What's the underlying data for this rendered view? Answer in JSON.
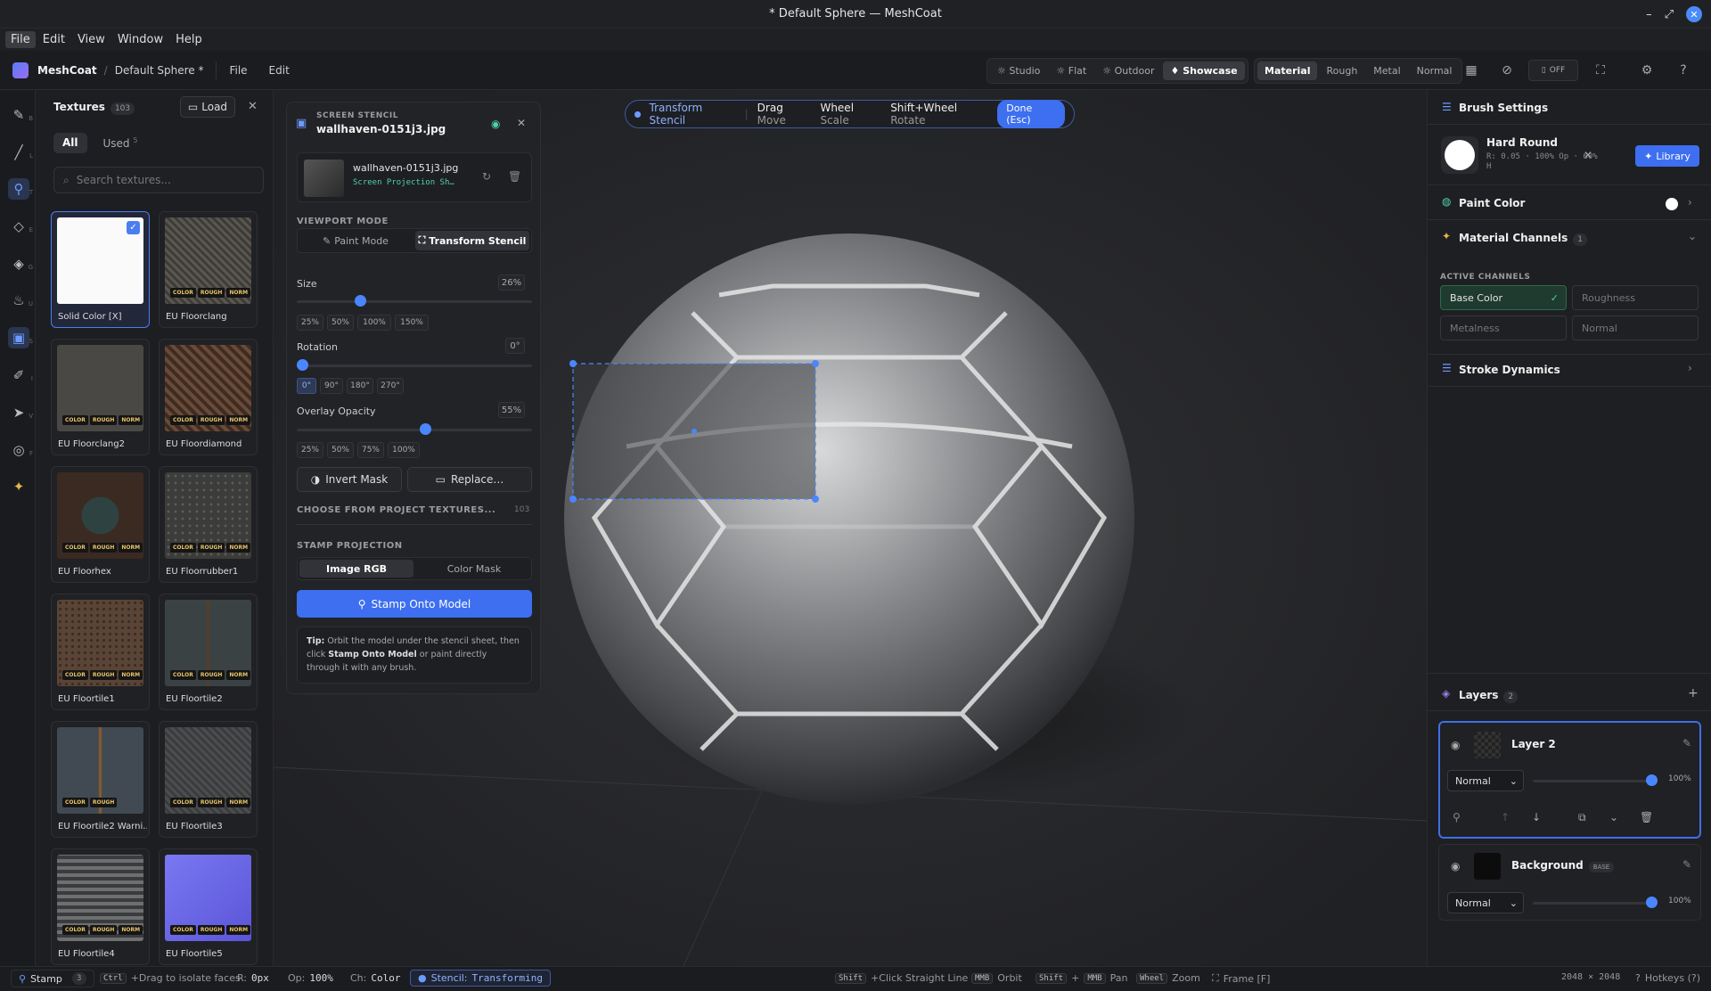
{
  "window": {
    "title": "* Default Sphere — MeshCoat"
  },
  "menubar": [
    "File",
    "Edit",
    "View",
    "Window",
    "Help"
  ],
  "toolbar": {
    "brand": "MeshCoat",
    "doc": "Default Sphere *",
    "menus": [
      "File",
      "Edit"
    ],
    "lighting": [
      "Studio",
      "Flat",
      "Outdoor",
      "Showcase"
    ],
    "lighting_active": "Showcase",
    "view_modes": [
      "Material",
      "Rough",
      "Metal",
      "Normal"
    ],
    "view_active": "Material",
    "symmetry": "OFF"
  },
  "rail_keys": [
    "B",
    "L",
    "T",
    "E",
    "G",
    "U",
    "S",
    "I",
    "V",
    "F"
  ],
  "textures": {
    "title": "Textures",
    "count": "103",
    "load": "Load",
    "tab_all": "All",
    "tab_used": "Used",
    "used_count": "5",
    "search_placeholder": "Search textures...",
    "items": [
      {
        "name": "Solid Color [X]",
        "tags": []
      },
      {
        "name": "EU Floorclang",
        "tags": [
          "COLOR",
          "ROUGH",
          "NORM"
        ]
      },
      {
        "name": "EU Floorclang2",
        "tags": [
          "COLOR",
          "ROUGH",
          "NORM"
        ]
      },
      {
        "name": "EU Floordiamond",
        "tags": [
          "COLOR",
          "ROUGH",
          "NORM"
        ]
      },
      {
        "name": "EU Floorhex",
        "tags": [
          "COLOR",
          "ROUGH",
          "NORM"
        ]
      },
      {
        "name": "EU Floorrubber1",
        "tags": [
          "COLOR",
          "ROUGH",
          "NORM"
        ]
      },
      {
        "name": "EU Floortile1",
        "tags": [
          "COLOR",
          "ROUGH",
          "NORM"
        ]
      },
      {
        "name": "EU Floortile2",
        "tags": [
          "COLOR",
          "ROUGH",
          "NORM"
        ]
      },
      {
        "name": "EU Floortile2 Warni...",
        "tags": [
          "COLOR",
          "ROUGH"
        ]
      },
      {
        "name": "EU Floortile3",
        "tags": [
          "COLOR",
          "ROUGH",
          "NORM"
        ]
      },
      {
        "name": "EU Floortile4",
        "tags": [
          "COLOR",
          "ROUGH",
          "NORM"
        ]
      },
      {
        "name": "EU Floortile5",
        "tags": [
          "COLOR",
          "ROUGH",
          "NORM"
        ]
      }
    ]
  },
  "stencil": {
    "kicker": "SCREEN STENCIL",
    "file": "wallhaven-0151j3.jpg",
    "file_sub": "Screen Projection Sh…",
    "viewport_mode_label": "VIEWPORT MODE",
    "paint_mode": "Paint Mode",
    "transform_stencil": "Transform Stencil",
    "size_label": "Size",
    "size_value": "26%",
    "size_fraction": 0.26,
    "size_presets": [
      "25%",
      "50%",
      "100%",
      "150%"
    ],
    "rotation_label": "Rotation",
    "rotation_value": "0°",
    "rotation_presets": [
      "0°",
      "90°",
      "180°",
      "270°"
    ],
    "opacity_label": "Overlay Opacity",
    "opacity_value": "55%",
    "opacity_fraction": 0.55,
    "opacity_presets": [
      "25%",
      "50%",
      "75%",
      "100%"
    ],
    "invert_mask": "Invert Mask",
    "replace": "Replace…",
    "choose": "CHOOSE FROM PROJECT TEXTURES...",
    "choose_count": "103",
    "projection_label": "STAMP PROJECTION",
    "image_rgb": "Image RGB",
    "color_mask": "Color Mask",
    "stamp_btn": "Stamp Onto Model",
    "tip_bold": "Tip:",
    "tip_1": " Orbit the model under the stencil sheet, then click ",
    "tip_bold2": "Stamp Onto Model",
    "tip_2": " or paint directly through it with any brush."
  },
  "overlay": {
    "mode": "Transform Stencil",
    "drag": "Drag",
    "drag_act": "Move",
    "wheel": "Wheel",
    "wheel_act": "Scale",
    "shiftwheel": "Shift+Wheel",
    "shiftwheel_act": "Rotate",
    "done": "Done (Esc)"
  },
  "brush": {
    "title": "Brush Settings",
    "name": "Hard Round",
    "params": "R: 0.05 · 100% Op · 60% H",
    "r": "R: 0.05",
    "op": "100% Op",
    "h": "60% H",
    "library": "Library",
    "paint_color": "Paint Color",
    "paint_color_hex": "#ffffff",
    "channels_title": "Material Channels",
    "channels_count": "1",
    "active_channels": "ACTIVE CHANNELS",
    "channels": [
      {
        "name": "Base Color",
        "on": true
      },
      {
        "name": "Roughness",
        "on": false
      },
      {
        "name": "Metalness",
        "on": false
      },
      {
        "name": "Normal",
        "on": false
      }
    ],
    "stroke": "Stroke Dynamics"
  },
  "layers": {
    "title": "Layers",
    "count": "2",
    "items": [
      {
        "name": "Layer 2",
        "blend": "Normal",
        "opacity": "100%",
        "opacity_fraction": 1.0,
        "badge": ""
      },
      {
        "name": "Background",
        "blend": "Normal",
        "opacity": "100%",
        "opacity_fraction": 1.0,
        "badge": "BASE"
      }
    ]
  },
  "status": {
    "tool": "Stamp",
    "tool_count": "3",
    "ctrl": "Ctrl",
    "ctrl_hint": "+Drag to isolate faces",
    "r_label": "R:",
    "r_val": "0px",
    "op_label": "Op:",
    "op_val": "100%",
    "ch_label": "Ch:",
    "ch_val": "Color",
    "stencil_label": "Stencil:",
    "stencil_val": "Transforming",
    "shift": "Shift",
    "shift_hint": "+Click Straight Line",
    "mmb": "MMB",
    "orbit": "Orbit",
    "shift2": "Shift",
    "plus": "+",
    "mmb2": "MMB",
    "pan": "Pan",
    "wheel": "Wheel",
    "zoom": "Zoom",
    "frame": "Frame [F]",
    "resolution": "2048 × 2048",
    "hotkeys": "Hotkeys (?)"
  },
  "colors": {
    "accent": "#3d6ff0",
    "bg": "#1b1c1f",
    "tag": "#e8c46a"
  }
}
